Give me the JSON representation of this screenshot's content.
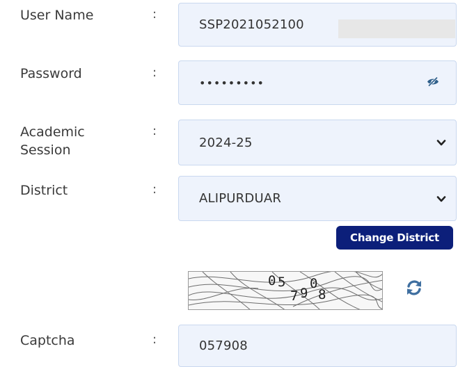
{
  "form": {
    "username": {
      "label": "User Name",
      "colon": ":",
      "value": "SSP2021052100"
    },
    "password": {
      "label": "Password",
      "colon": ":",
      "value": "•••••••••"
    },
    "session": {
      "label_line1": "Academic",
      "label_line2": "Session",
      "colon": ":",
      "value": "2024-25"
    },
    "district": {
      "label": "District",
      "colon": ":",
      "value": "ALIPURDUAR"
    },
    "change_district_label": "Change District",
    "captcha_image": {
      "chars": [
        "0",
        "5",
        "7",
        "9",
        "0",
        "8"
      ]
    },
    "captcha": {
      "label": "Captcha",
      "colon": ":",
      "value": "057908"
    }
  },
  "icons": {
    "password_toggle": "eye-slash-icon",
    "select_arrow": "chevron-down-icon",
    "refresh": "refresh-icon"
  },
  "colors": {
    "field_background": "#eef3fc",
    "field_border": "#c9d8ef",
    "button_background": "#0c1f7a",
    "refresh_icon": "#3f6fa0"
  }
}
